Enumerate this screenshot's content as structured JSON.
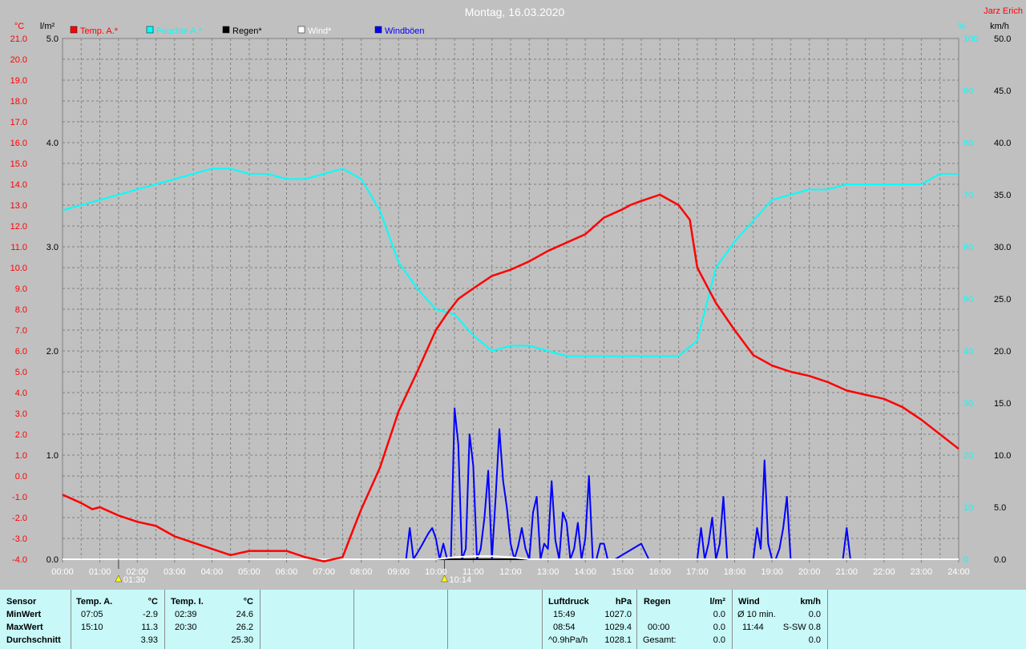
{
  "chart_data": {
    "type": "line",
    "title": "Montag, 16.03.2020",
    "author": "Jarz Erich",
    "x_ticks": [
      "00:00",
      "01:00",
      "02:00",
      "03:00",
      "04:00",
      "05:00",
      "06:00",
      "07:00",
      "08:00",
      "09:00",
      "10:00",
      "11:00",
      "12:00",
      "13:00",
      "14:00",
      "15:00",
      "16:00",
      "17:00",
      "18:00",
      "19:00",
      "20:00",
      "21:00",
      "22:00",
      "23:00",
      "24:00"
    ],
    "xlim": [
      0,
      24
    ],
    "axes": {
      "temp": {
        "unit": "°C",
        "min": -4,
        "max": 21,
        "step": 1,
        "ticks": [
          "-4.0",
          "-3.0",
          "-2.0",
          "-1.0",
          "0.0",
          "1.0",
          "2.0",
          "3.0",
          "4.0",
          "5.0",
          "6.0",
          "7.0",
          "8.0",
          "9.0",
          "10.0",
          "11.0",
          "12.0",
          "13.0",
          "14.0",
          "15.0",
          "16.0",
          "17.0",
          "18.0",
          "19.0",
          "20.0",
          "21.0"
        ],
        "color": "#ff0000"
      },
      "rain": {
        "unit": "l/m²",
        "min": 0,
        "max": 5,
        "step": 1,
        "ticks": [
          "0.0",
          "1.0",
          "2.0",
          "3.0",
          "4.0",
          "5.0"
        ],
        "color": "#000000"
      },
      "humidity": {
        "unit": "%",
        "min": 0,
        "max": 100,
        "step": 10,
        "ticks": [
          "0",
          "10",
          "20",
          "30",
          "40",
          "50",
          "60",
          "70",
          "80",
          "90",
          "100"
        ],
        "color": "#00ffff"
      },
      "wind": {
        "unit": "km/h",
        "min": 0,
        "max": 50,
        "step": 5,
        "ticks": [
          "0.0",
          "5.0",
          "10.0",
          "15.0",
          "20.0",
          "25.0",
          "30.0",
          "35.0",
          "40.0",
          "45.0",
          "50.0"
        ],
        "color": "#000000"
      }
    },
    "grid": true,
    "legend_position": "top-left",
    "series": [
      {
        "name": "Temp. A.*",
        "color": "#ff0000",
        "axis": "temp",
        "x": [
          0,
          0.5,
          0.8,
          1,
          1.5,
          2,
          2.5,
          3,
          3.5,
          4,
          4.5,
          5,
          5.5,
          6,
          6.5,
          7,
          7.5,
          7.8,
          8,
          8.5,
          9,
          9.5,
          10,
          10.3,
          10.6,
          11,
          11.5,
          12,
          12.5,
          13,
          13.5,
          14,
          14.5,
          15,
          15.2,
          15.5,
          16,
          16.5,
          16.8,
          17,
          17.5,
          18,
          18.5,
          19,
          19.5,
          20,
          20.5,
          21,
          21.5,
          22,
          22.5,
          23,
          23.5,
          24
        ],
        "y": [
          -0.9,
          -1.3,
          -1.6,
          -1.5,
          -1.9,
          -2.2,
          -2.4,
          -2.9,
          -3.2,
          -3.5,
          -3.8,
          -3.6,
          -3.6,
          -3.6,
          -3.9,
          -4.1,
          -3.9,
          -2.5,
          -1.6,
          0.4,
          3.1,
          5.0,
          7.0,
          7.8,
          8.5,
          9.0,
          9.6,
          9.9,
          10.3,
          10.8,
          11.2,
          11.6,
          12.4,
          12.8,
          13.0,
          13.2,
          13.5,
          13.0,
          12.3,
          10.0,
          8.3,
          7.0,
          5.8,
          5.3,
          5.0,
          4.8,
          4.5,
          4.1,
          3.9,
          3.7,
          3.3,
          2.7,
          2.0,
          1.3
        ]
      },
      {
        "name": "Feuchte A.*",
        "color": "#00ffff",
        "axis": "humidity",
        "x": [
          0,
          0.5,
          1,
          1.5,
          2,
          2.5,
          3,
          3.5,
          4,
          4.5,
          5,
          5.5,
          6,
          6.5,
          7,
          7.5,
          8,
          8.5,
          9,
          9.5,
          10,
          10.5,
          11,
          11.5,
          12,
          12.5,
          13,
          13.5,
          14,
          14.5,
          15,
          15.5,
          16,
          16.5,
          17,
          17.5,
          18,
          18.5,
          19,
          19.5,
          20,
          20.5,
          21,
          21.5,
          22,
          22.5,
          23,
          23.5,
          24
        ],
        "y": [
          67,
          68,
          69,
          70,
          71,
          72,
          73,
          74,
          75,
          75,
          74,
          74,
          73,
          73,
          74,
          75,
          73,
          67,
          57,
          52,
          48,
          47,
          43,
          40,
          41,
          41,
          40,
          39,
          39,
          39,
          39,
          39,
          39,
          39,
          42,
          56,
          61,
          65,
          69,
          70,
          71,
          71,
          72,
          72,
          72,
          72,
          72,
          74,
          74
        ]
      },
      {
        "name": "Regen*",
        "color": "#000000",
        "axis": "rain",
        "x": [
          0,
          24
        ],
        "y": [
          0,
          0
        ]
      },
      {
        "name": "Wind*",
        "color": "#ffffff",
        "axis": "wind",
        "x": [
          0,
          10,
          10.5,
          11,
          11.5,
          12,
          12.5,
          24
        ],
        "y": [
          0,
          0,
          0.2,
          0.3,
          0.3,
          0.2,
          0,
          0
        ]
      },
      {
        "name": "Windböen",
        "color": "#0000ff",
        "axis": "wind",
        "x": [
          9.2,
          9.3,
          9.4,
          9.6,
          9.8,
          9.9,
          10.0,
          10.1,
          10.2,
          10.3,
          10.4,
          10.5,
          10.6,
          10.7,
          10.8,
          10.9,
          11.0,
          11.1,
          11.2,
          11.3,
          11.4,
          11.5,
          11.6,
          11.7,
          11.8,
          11.9,
          12.0,
          12.1,
          12.2,
          12.3,
          12.4,
          12.5,
          12.6,
          12.7,
          12.8,
          12.9,
          13.0,
          13.1,
          13.2,
          13.3,
          13.4,
          13.5,
          13.6,
          13.7,
          13.8,
          13.9,
          14.0,
          14.1,
          14.2,
          14.3,
          14.4,
          14.5,
          14.6,
          14.7,
          14.8,
          15.5,
          15.7,
          16.0,
          16.5,
          17.0,
          17.1,
          17.2,
          17.3,
          17.4,
          17.5,
          17.6,
          17.7,
          17.8,
          17.9,
          18.0,
          18.2,
          18.5,
          18.6,
          18.7,
          18.8,
          18.9,
          19.0,
          19.1,
          19.2,
          19.3,
          19.4,
          19.5,
          19.6,
          20.9,
          21.0,
          21.1
        ],
        "y": [
          0,
          3.0,
          0,
          1.2,
          2.5,
          3.0,
          2.0,
          0,
          1.5,
          0,
          0,
          14.5,
          11.0,
          0,
          1.0,
          12.0,
          9.0,
          0,
          1.0,
          4.0,
          8.5,
          0,
          6.0,
          12.5,
          7.5,
          5.0,
          1.5,
          0,
          1.2,
          3.0,
          1.0,
          0,
          4.5,
          6.0,
          0,
          1.5,
          1.0,
          7.5,
          1.8,
          0,
          4.5,
          3.5,
          0,
          1.0,
          3.5,
          0,
          2.0,
          8.0,
          0,
          0,
          1.5,
          1.5,
          0,
          0,
          0,
          1.5,
          0,
          0,
          0,
          0,
          3.0,
          0,
          1.5,
          4.0,
          0,
          1.5,
          6.0,
          0,
          0,
          0,
          0,
          0,
          3.0,
          1.0,
          9.5,
          1.5,
          0,
          0,
          1.0,
          3.0,
          6.0,
          0,
          0,
          0,
          3.0,
          0
        ]
      }
    ],
    "markers": [
      {
        "label": "01:30",
        "x": 1.5
      },
      {
        "label": "10:14",
        "x": 10.23
      }
    ]
  },
  "table": {
    "rows": [
      "Sensor",
      "MinWert",
      "MaxWert",
      "Durchschnitt"
    ],
    "temp_a": {
      "header": "Temp. A.",
      "unit": "°C",
      "min_time": "07:05",
      "min_val": "-2.9",
      "max_time": "15:10",
      "max_val": "11.3",
      "avg": "3.93"
    },
    "temp_i": {
      "header": "Temp. I.",
      "unit": "°C",
      "min_time": "02:39",
      "min_val": "24.6",
      "max_time": "20:30",
      "max_val": "26.2",
      "avg": "25.30"
    },
    "pressure": {
      "header": "Luftdruck",
      "unit": "hPa",
      "min_time": "15:49",
      "min_val": "1027.0",
      "max_time": "08:54",
      "max_val": "1029.4",
      "trend_label": "^0.9hPa/h",
      "trend_val": "1028.1"
    },
    "rain": {
      "header": "Regen",
      "unit": "l/m²",
      "time": "00:00",
      "val": "0.0",
      "total_label": "Gesamt:",
      "total_val": "0.0",
      "first_val": "0.0"
    },
    "wind": {
      "header": "Wind",
      "unit": "km/h",
      "avg_label": "Ø 10 min.",
      "avg_val": "0.0",
      "max_time": "11:44",
      "max_dir_val": "S-SW 0.8",
      "last_val": "0.0"
    }
  }
}
